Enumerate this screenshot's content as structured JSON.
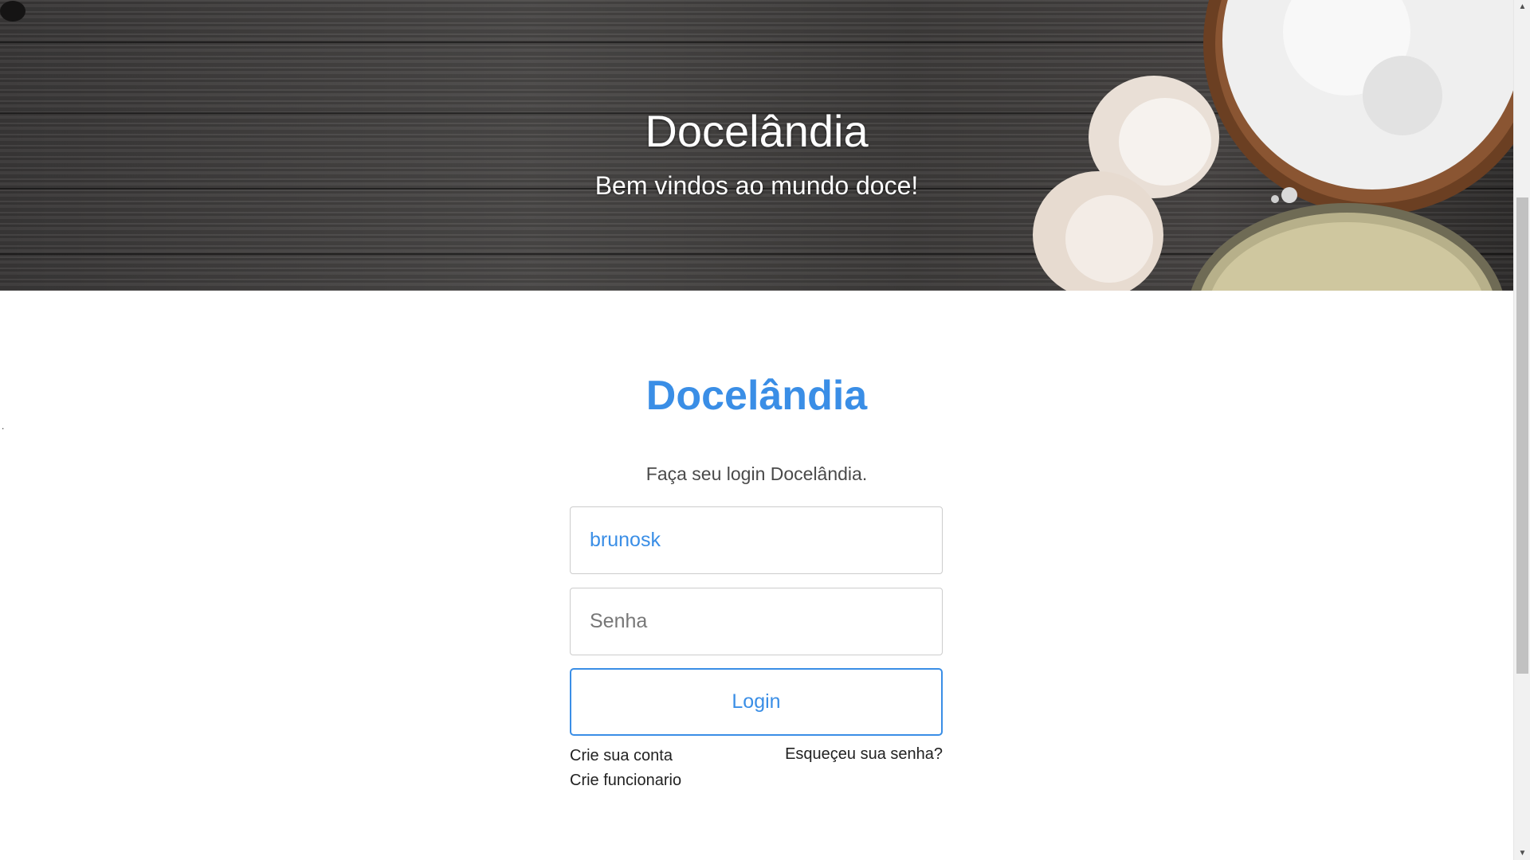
{
  "hero": {
    "title": "Docelândia",
    "subtitle": "Bem vindos ao mundo doce!"
  },
  "login": {
    "brand": "Docelândia",
    "intro": "Faça seu login Docelândia.",
    "username_value": "brunosk",
    "password_placeholder": "Senha",
    "login_label": "Login",
    "create_account_label": "Crie sua conta",
    "create_employee_label": "Crie funcionario",
    "forgot_password_label": "Esqueçeu sua senha?"
  },
  "stray_text": ".",
  "colors": {
    "accent": "#3a8ee6",
    "wood_dark": "#3a3838",
    "text_dark": "#222222"
  },
  "icons": {
    "scroll_up": "scroll-up-arrow-icon",
    "scroll_down": "scroll-down-arrow-icon"
  }
}
